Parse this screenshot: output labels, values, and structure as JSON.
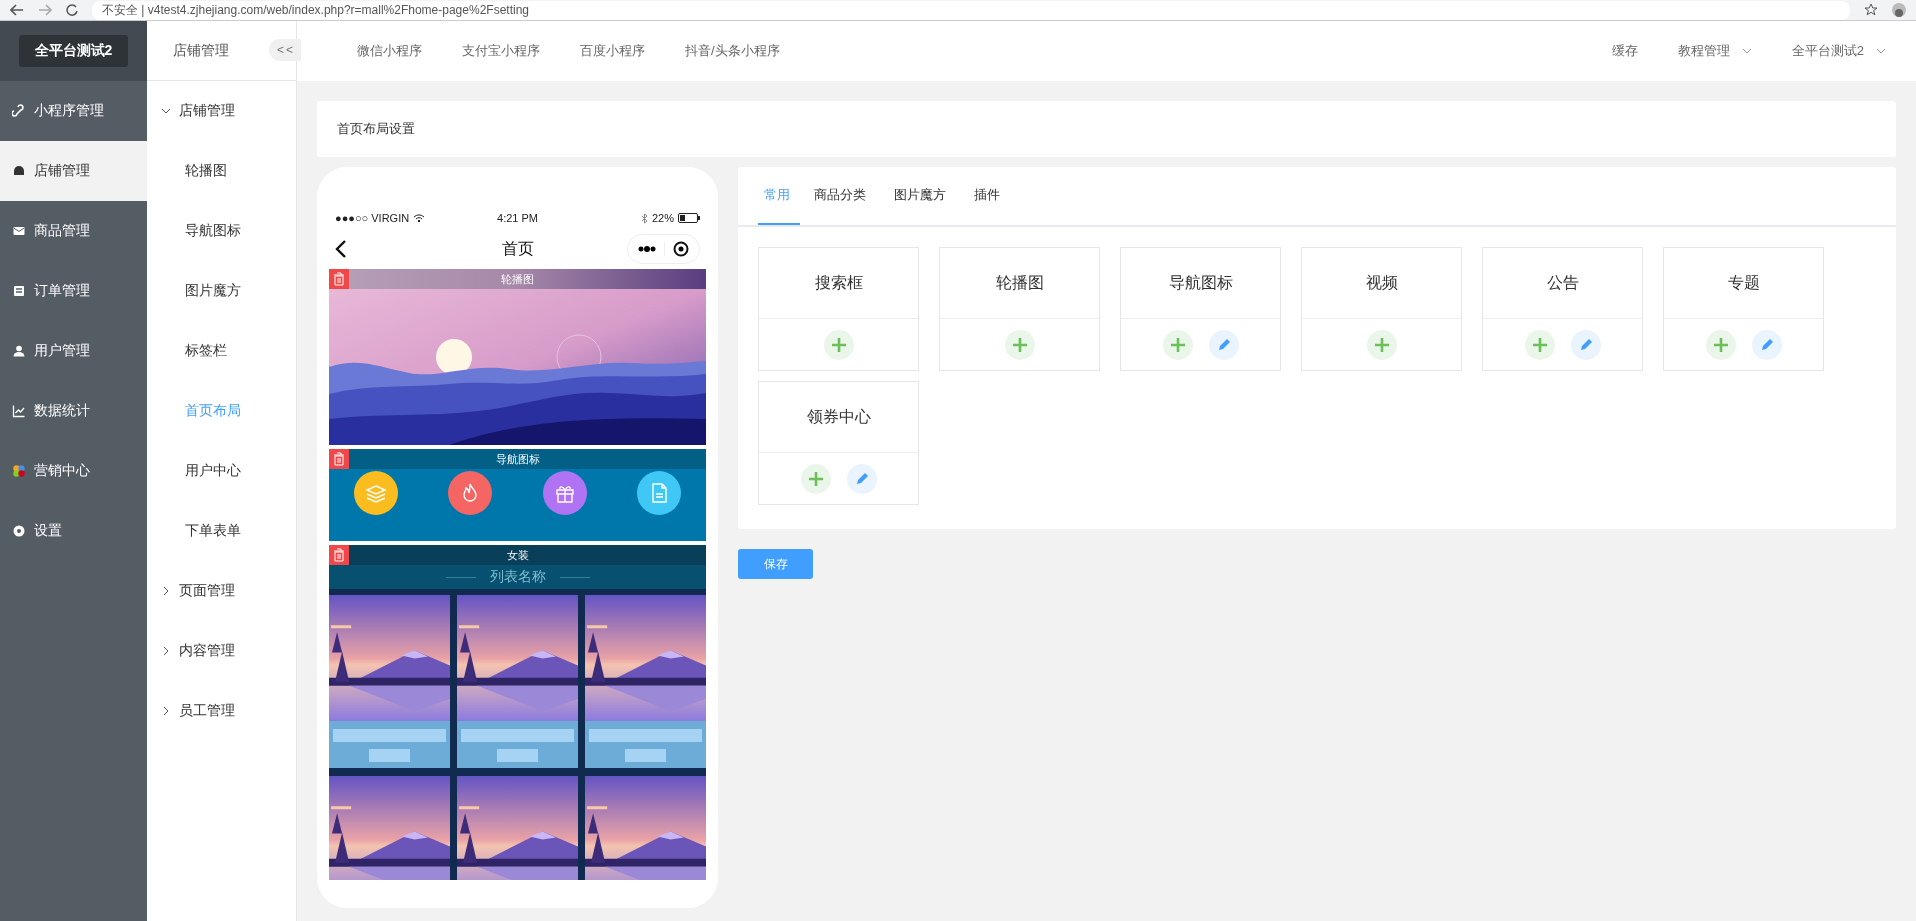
{
  "browser": {
    "address": "不安全 | v4test4.zjhejiang.com/web/index.php?r=mall%2Fhome-page%2Fsetting"
  },
  "sidebar": {
    "brand": "全平台测试2",
    "items": [
      {
        "label": "小程序管理",
        "selected": false
      },
      {
        "label": "店铺管理",
        "selected": true
      },
      {
        "label": "商品管理",
        "selected": false
      },
      {
        "label": "订单管理",
        "selected": false
      },
      {
        "label": "用户管理",
        "selected": false
      },
      {
        "label": "数据统计",
        "selected": false
      },
      {
        "label": "营销中心",
        "selected": false
      },
      {
        "label": "设置",
        "selected": false
      }
    ]
  },
  "submenu": {
    "title": "店铺管理",
    "collapse": "<<",
    "groups": [
      {
        "label": "店铺管理",
        "expanded": true,
        "children": [
          {
            "label": "轮播图",
            "selected": false
          },
          {
            "label": "导航图标",
            "selected": false
          },
          {
            "label": "图片魔方",
            "selected": false
          },
          {
            "label": "标签栏",
            "selected": false
          },
          {
            "label": "首页布局",
            "selected": true
          },
          {
            "label": "用户中心",
            "selected": false
          },
          {
            "label": "下单表单",
            "selected": false
          }
        ]
      },
      {
        "label": "页面管理",
        "expanded": false
      },
      {
        "label": "内容管理",
        "expanded": false
      },
      {
        "label": "员工管理",
        "expanded": false
      }
    ]
  },
  "header": {
    "tabs": [
      "微信小程序",
      "支付宝小程序",
      "百度小程序",
      "抖音/头条小程序"
    ],
    "actions": [
      {
        "label": "缓存",
        "dropdown": false
      },
      {
        "label": "教程管理",
        "dropdown": true
      },
      {
        "label": "全平台测试2",
        "dropdown": true
      }
    ]
  },
  "breadcrumb": "首页布局设置",
  "phone": {
    "carrier": "●●●○○ VIRGIN",
    "time": "4:21 PM",
    "battery": "22%",
    "title": "首页",
    "blocks": [
      {
        "kind": "banner",
        "label": "轮播图"
      },
      {
        "kind": "nav",
        "label": "导航图标",
        "icons": [
          {
            "color": "#fbbc1f"
          },
          {
            "color": "#f56563"
          },
          {
            "color": "#b073f3"
          },
          {
            "color": "#3fc8f6"
          }
        ]
      },
      {
        "kind": "list",
        "label": "女装",
        "heading": "列表名称"
      }
    ]
  },
  "components": {
    "tabs": [
      {
        "label": "常用",
        "selected": true
      },
      {
        "label": "商品分类",
        "selected": false
      },
      {
        "label": "图片魔方",
        "selected": false
      },
      {
        "label": "插件",
        "selected": false
      }
    ],
    "widgets": [
      {
        "name": "搜索框",
        "editable": false
      },
      {
        "name": "轮播图",
        "editable": false
      },
      {
        "name": "导航图标",
        "editable": true
      },
      {
        "name": "视频",
        "editable": false
      },
      {
        "name": "公告",
        "editable": true
      },
      {
        "name": "专题",
        "editable": true
      },
      {
        "name": "领券中心",
        "editable": true
      }
    ]
  },
  "save": "保存"
}
